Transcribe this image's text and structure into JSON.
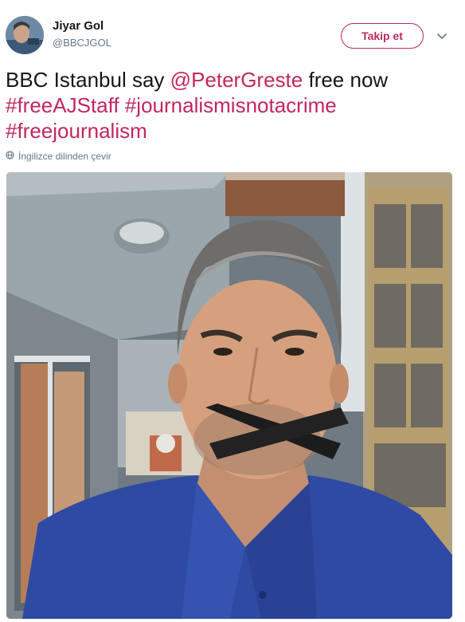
{
  "user": {
    "name": "Jiyar Gol",
    "handle": "@BBCJGOL"
  },
  "actions": {
    "follow_label": "Takip et"
  },
  "tweet": {
    "text_plain": "BBC Istanbul say",
    "mention": "@PeterGreste",
    "text_after_mention": "free now",
    "hashtags": [
      "#freeAJStaff",
      "#journalismisnotacrime",
      "#freejournalism"
    ]
  },
  "translate_label": "İngilizce dilinden çevir",
  "icons": {
    "caret": "chevron-down-icon",
    "translate": "globe-icon"
  },
  "colors": {
    "accent": "#c1275d",
    "secondary_text": "#657786",
    "primary_text": "#14171a"
  }
}
